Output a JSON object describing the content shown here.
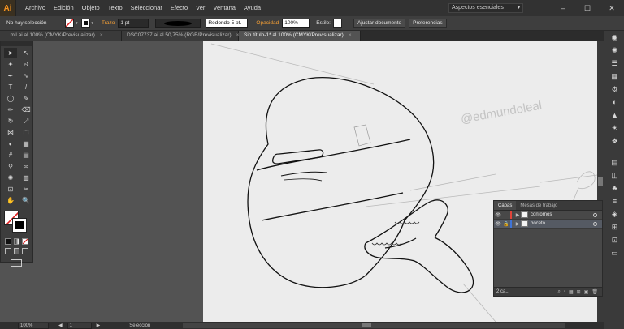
{
  "app": {
    "logo": "Ai"
  },
  "menu": [
    "Archivo",
    "Edición",
    "Objeto",
    "Texto",
    "Seleccionar",
    "Efecto",
    "Ver",
    "Ventana",
    "Ayuda"
  ],
  "workspace": {
    "label": "Aspectos esenciales",
    "arrow": "▾"
  },
  "window_controls": {
    "minimize": "–",
    "maximize": "☐",
    "close": "✕"
  },
  "control": {
    "selection": "No hay selección",
    "stroke_label": "Trazo",
    "stroke_weight": "1 pt",
    "brush": "Redondo 5 pt.",
    "opacity_label": "Opacidad",
    "opacity_value": "100%",
    "style_label": "Estilo:",
    "fit_doc": "Ajustar documento",
    "prefs": "Preferencias"
  },
  "tabs": [
    {
      "label": "…mil.ai al 100% (CMYK/Previsualizar)",
      "active": false
    },
    {
      "label": "DSC07737.ai al 50,75% (RGB/Previsualizar)",
      "active": false
    },
    {
      "label": "Sin título-1* al 100% (CMYK/Previsualizar)",
      "active": true
    }
  ],
  "tab_close": "×",
  "tools": [
    {
      "name": "selection-tool",
      "glyph": "➤"
    },
    {
      "name": "direct-selection-tool",
      "glyph": "↖"
    },
    {
      "name": "magic-wand-tool",
      "glyph": "✦"
    },
    {
      "name": "lasso-tool",
      "glyph": "ᘐ"
    },
    {
      "name": "pen-tool",
      "glyph": "✒"
    },
    {
      "name": "curvature-tool",
      "glyph": "∿"
    },
    {
      "name": "type-tool",
      "glyph": "T"
    },
    {
      "name": "line-tool",
      "glyph": "/"
    },
    {
      "name": "ellipse-tool",
      "glyph": "◯"
    },
    {
      "name": "paintbrush-tool",
      "glyph": "✎"
    },
    {
      "name": "pencil-tool",
      "glyph": "✏"
    },
    {
      "name": "eraser-tool",
      "glyph": "⌫"
    },
    {
      "name": "rotate-tool",
      "glyph": "↻"
    },
    {
      "name": "scale-tool",
      "glyph": "⤢"
    },
    {
      "name": "width-tool",
      "glyph": "⋈"
    },
    {
      "name": "free-transform-tool",
      "glyph": "⬚"
    },
    {
      "name": "shape-builder-tool",
      "glyph": "◐"
    },
    {
      "name": "perspective-tool",
      "glyph": "▦"
    },
    {
      "name": "mesh-tool",
      "glyph": "#"
    },
    {
      "name": "gradient-tool",
      "glyph": "▤"
    },
    {
      "name": "eyedropper-tool",
      "glyph": "⚲"
    },
    {
      "name": "blend-tool",
      "glyph": "∞"
    },
    {
      "name": "symbol-sprayer-tool",
      "glyph": "✺"
    },
    {
      "name": "column-graph-tool",
      "glyph": "▥"
    },
    {
      "name": "artboard-tool",
      "glyph": "⊡"
    },
    {
      "name": "slice-tool",
      "glyph": "✂"
    },
    {
      "name": "hand-tool",
      "glyph": "✋"
    },
    {
      "name": "zoom-tool",
      "glyph": "🔍"
    }
  ],
  "layers_panel": {
    "tabs": [
      "Capas",
      "Mesas de trabajo"
    ],
    "rows": [
      {
        "name": "contornos",
        "color": "#e0443a",
        "selected": false
      },
      {
        "name": "boceto",
        "color": "#3f74d8",
        "selected": true
      }
    ],
    "count": "2 ca...",
    "visibility_glyph": "👁",
    "lock_glyph": "🔒",
    "expand_glyph": "▶",
    "footer_icons": [
      "⌕",
      "▫",
      "▦",
      "⊞",
      "▣",
      "🗑"
    ]
  },
  "dock_icons": [
    "◉",
    "✺",
    "☰",
    "▦",
    "⚙",
    "◐",
    "▲",
    "☀",
    "❖",
    "▤",
    "◫",
    "♣",
    "≡",
    "◈",
    "⊞",
    "⊡",
    "▭"
  ],
  "status": {
    "zoom": "100%",
    "artboard": "1",
    "tool": "Selección",
    "nav_prev": "◀",
    "nav_next": "▶"
  },
  "artwork": {
    "signature": "@edmundoleal"
  }
}
